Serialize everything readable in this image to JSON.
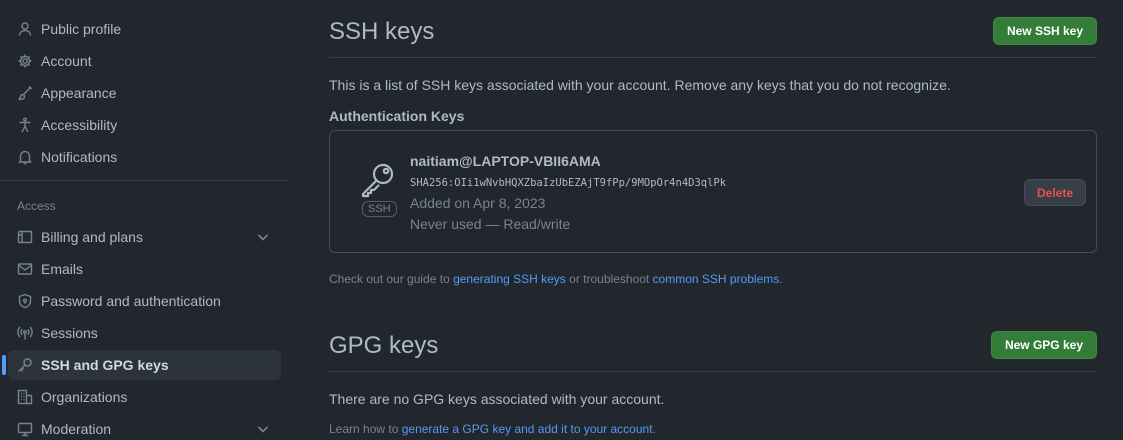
{
  "sidebar": {
    "items_top": [
      {
        "label": "Public profile",
        "icon": "person-icon"
      },
      {
        "label": "Account",
        "icon": "gear-icon"
      },
      {
        "label": "Appearance",
        "icon": "paintbrush-icon"
      },
      {
        "label": "Accessibility",
        "icon": "accessibility-icon"
      },
      {
        "label": "Notifications",
        "icon": "bell-icon"
      }
    ],
    "access_label": "Access",
    "items_access": [
      {
        "label": "Billing and plans",
        "icon": "billing-icon",
        "expandable": true
      },
      {
        "label": "Emails",
        "icon": "mail-icon"
      },
      {
        "label": "Password and authentication",
        "icon": "shield-lock-icon"
      },
      {
        "label": "Sessions",
        "icon": "broadcast-icon"
      },
      {
        "label": "SSH and GPG keys",
        "icon": "key-icon",
        "active": true
      },
      {
        "label": "Organizations",
        "icon": "organization-icon"
      },
      {
        "label": "Moderation",
        "icon": "moderation-icon",
        "expandable": true
      }
    ]
  },
  "ssh": {
    "title": "SSH keys",
    "new_button": "New SSH key",
    "description": "This is a list of SSH keys associated with your account. Remove any keys that you do not recognize.",
    "auth_heading": "Authentication Keys",
    "key": {
      "badge": "SSH",
      "title": "naitiam@LAPTOP-VBII6AMA",
      "fingerprint": "SHA256:OIi1wNvbHQXZbaIzUbEZAjT9fPp/9MOpOr4n4D3qlPk",
      "added": "Added on Apr 8, 2023",
      "usage": "Never used — Read/write",
      "delete_label": "Delete"
    },
    "note": {
      "prefix": "Check out our guide to ",
      "link1": "generating SSH keys",
      "middle": " or troubleshoot ",
      "link2": "common SSH problems",
      "suffix": "."
    }
  },
  "gpg": {
    "title": "GPG keys",
    "new_button": "New GPG key",
    "empty": "There are no GPG keys associated with your account.",
    "note": {
      "prefix": "Learn how to ",
      "link": "generate a GPG key and add it to your account",
      "suffix": "."
    }
  },
  "colors": {
    "background": "#22272e",
    "accent": "#539bf5",
    "primary_button": "#347d39",
    "danger": "#e5534b"
  }
}
